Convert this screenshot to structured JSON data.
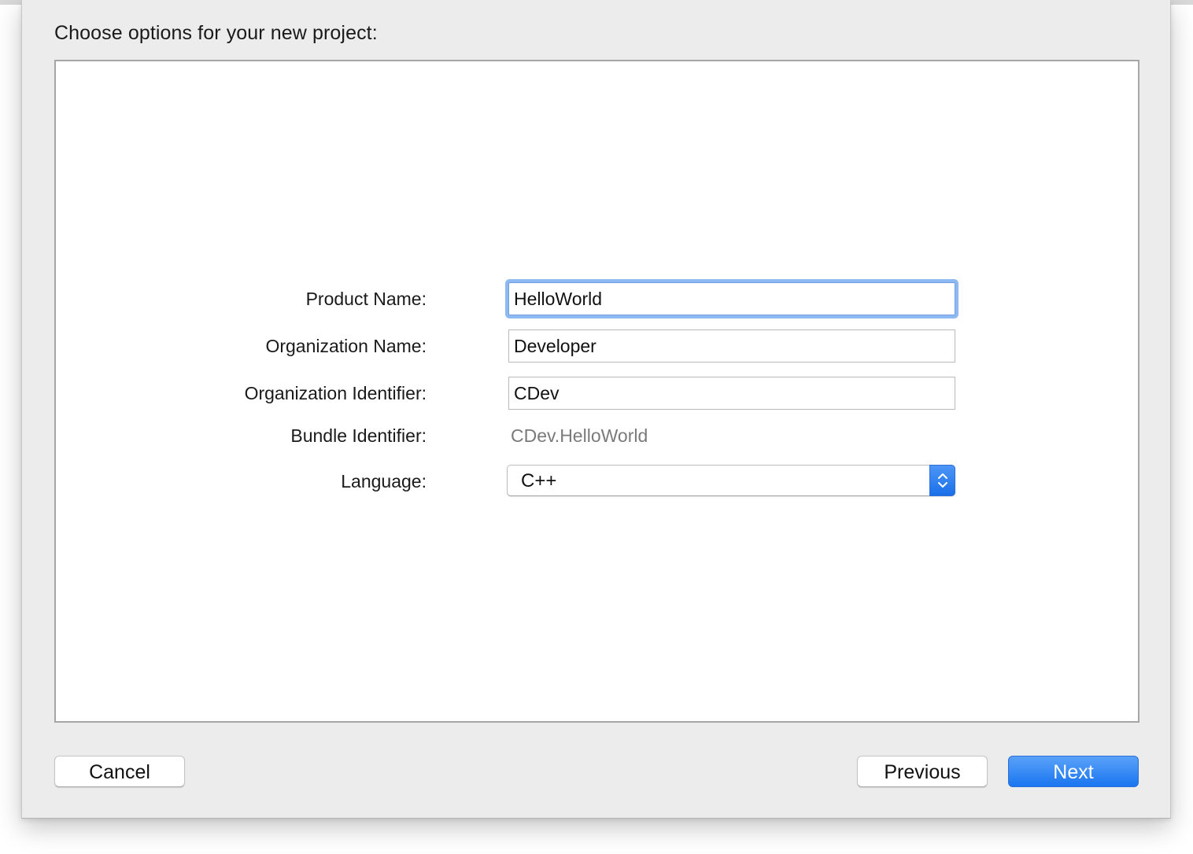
{
  "dialog": {
    "heading": "Choose options for your new project:"
  },
  "form": {
    "product_name": {
      "label": "Product Name:",
      "value": "HelloWorld"
    },
    "organization_name": {
      "label": "Organization Name:",
      "value": "Developer"
    },
    "organization_identifier": {
      "label": "Organization Identifier:",
      "value": "CDev"
    },
    "bundle_identifier": {
      "label": "Bundle Identifier:",
      "value": "CDev.HelloWorld"
    },
    "language": {
      "label": "Language:",
      "value": "C++"
    }
  },
  "buttons": {
    "cancel": "Cancel",
    "previous": "Previous",
    "next": "Next"
  },
  "colors": {
    "accent": "#1a75f0",
    "focus_ring": "#8fb9f2",
    "background": "#ececec"
  }
}
